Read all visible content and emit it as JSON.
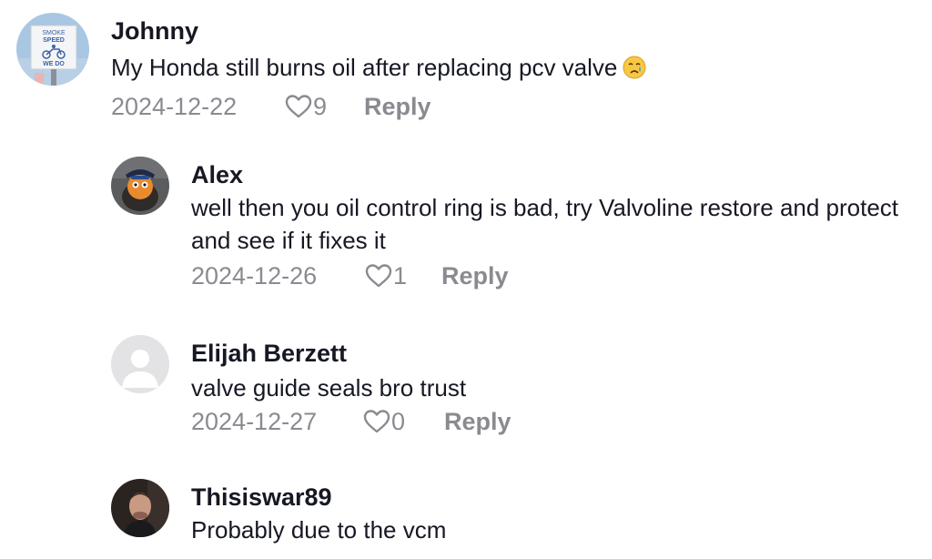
{
  "comments": [
    {
      "author": "Johnny",
      "text": "My Honda still burns oil after replacing pcv valve",
      "emoji": "crying-face",
      "date": "2024-12-22",
      "likes": "9",
      "reply_label": "Reply",
      "avatar_sign": {
        "line1": "SMOKE",
        "line2": "SPEED",
        "line3": "WE DO"
      }
    },
    {
      "author": "Alex",
      "text": "well then you oil control ring is bad, try Valvoline restore and protect and see if it fixes it",
      "date": "2024-12-26",
      "likes": "1",
      "reply_label": "Reply"
    },
    {
      "author": "Elijah Berzett",
      "text": "valve guide seals bro trust",
      "date": "2024-12-27",
      "likes": "0",
      "reply_label": "Reply"
    },
    {
      "author": "Thisiswar89",
      "text": "Probably due to the vcm"
    }
  ],
  "colors": {
    "text": "#161823",
    "secondary": "#8a8b91",
    "default_avatar_bg": "#e3e3e5",
    "default_avatar_fg": "#ffffff"
  }
}
